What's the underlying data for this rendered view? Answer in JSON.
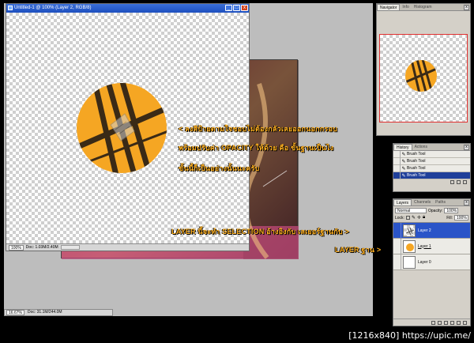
{
  "document_window": {
    "title": "Untitled-1 @ 100% (Layer 2, RGB/8)",
    "minimize": "_",
    "maximize": "□",
    "close": "x",
    "zoom": "100%",
    "doc_info": "Doc: 1.03M/2.40M"
  },
  "main_status": {
    "zoom": "16.67%",
    "doc_info": "Doc: 31.1M/244.0M"
  },
  "annotations": {
    "line1": "< ลงสีป้ายตามใจชอบไม่ต้องกลัวเลยออกนอกกรอบ",
    "line2": "พร้อมปรับค่า OPACITY ให้ด้วย คือ ขั้นฐานเป็นไง",
    "line3": "ขั้นนี้ก็เป็นอย่างนั้นนะครับ",
    "line4": "LAYER นี้จะทำ SELECTION อ้างอิงกับ เลเยอร์ฐานกับ >",
    "line5": "LAYER ฐาน >"
  },
  "navigator": {
    "tabs": [
      "Navigator",
      "Info",
      "Histogram"
    ],
    "close": "x"
  },
  "history": {
    "tabs": [
      "History",
      "Actions"
    ],
    "close": "x",
    "items": [
      "Brush Tool",
      "Brush Tool",
      "Brush Tool",
      "Brush Tool"
    ]
  },
  "layers": {
    "tabs": [
      "Layers",
      "Channels",
      "Paths"
    ],
    "close": "x",
    "blend_mode": "Normal",
    "opacity_label": "Opacity:",
    "opacity_value": "100%",
    "lock_label": "Lock:",
    "fill_label": "Fill:",
    "fill_value": "100%",
    "items": [
      "Layer 2",
      "Layer 1",
      "Layer 0"
    ]
  },
  "watermark": "[1216x840] https://upic.me/",
  "colors": {
    "accent_orange": "#f5a623",
    "annotation": "#ffb020",
    "selection_blue": "#2a54c8"
  }
}
